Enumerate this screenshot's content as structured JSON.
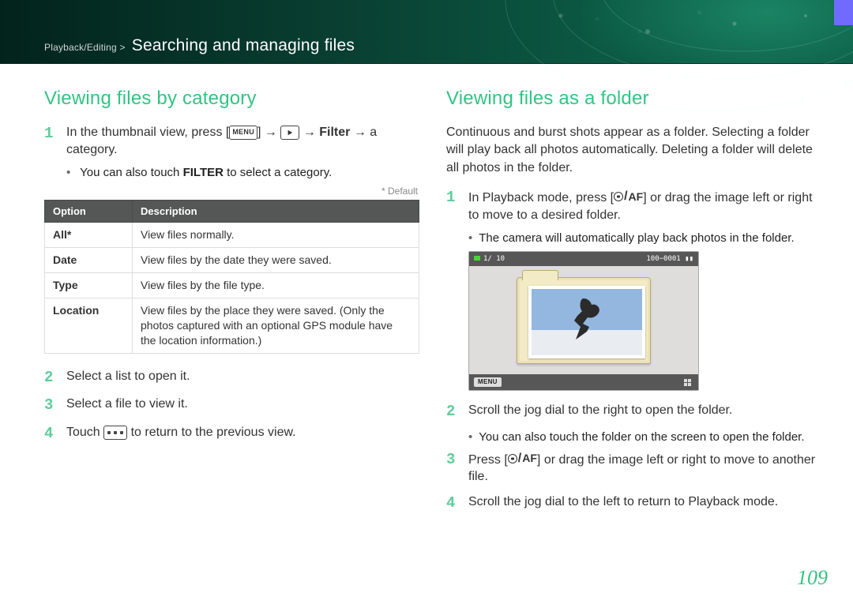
{
  "breadcrumb": {
    "path": "Playback/Editing >",
    "title": "Searching and managing files"
  },
  "left": {
    "heading": "Viewing files by category",
    "step1_a": "In the thumbnail view, press [",
    "step1_b": "] → ",
    "step1_c": " → ",
    "step1_filter": "Filter",
    "step1_d": " → a category.",
    "sub1": "You can also touch ",
    "sub1_bold": "FILTER",
    "sub1_b": " to select a category.",
    "default": "* Default",
    "table": {
      "h1": "Option",
      "h2": "Description",
      "rows": [
        {
          "k": "All*",
          "v": "View files normally."
        },
        {
          "k": "Date",
          "v": "View files by the date they were saved."
        },
        {
          "k": "Type",
          "v": "View files by the file type."
        },
        {
          "k": "Location",
          "v": "View files by the place they were saved. (Only the photos captured with an optional GPS module have the location information.)"
        }
      ]
    },
    "step2": "Select a list to open it.",
    "step3": "Select a file to view it.",
    "step4_a": "Touch ",
    "step4_b": " to return to the previous view."
  },
  "right": {
    "heading": "Viewing files as a folder",
    "intro": "Continuous and burst shots appear as a folder. Selecting a folder will play back all photos automatically. Deleting a folder will delete all photos in the folder.",
    "step1_a": "In Playback mode, press [",
    "step1_b": "] or drag the image left or right to move to a desired folder.",
    "sub1": "The camera will automatically play back photos in the folder.",
    "screen": {
      "count": "1/ 10",
      "code": "100−0001",
      "menu": "MENU"
    },
    "step2": "Scroll the jog dial to the right to open the folder.",
    "sub2": "You can also touch the folder on the screen to open the folder.",
    "step3_a": "Press [",
    "step3_b": "] or drag the image left or right to move to another file.",
    "step4": "Scroll the jog dial to the left to return to Playback mode."
  },
  "pagenum": "109",
  "nums": {
    "n1": "1",
    "n2": "2",
    "n3": "3",
    "n4": "4"
  }
}
